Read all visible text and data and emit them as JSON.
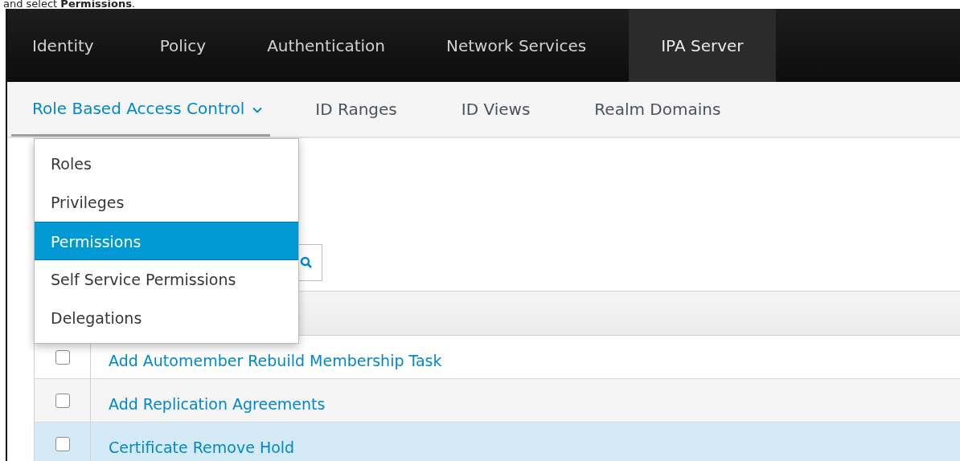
{
  "caption": "and select **Permissions**.",
  "top_nav": [
    {
      "label": "Identity",
      "selected": false
    },
    {
      "label": "Policy",
      "selected": false
    },
    {
      "label": "Authentication",
      "selected": false
    },
    {
      "label": "Network Services",
      "selected": false
    },
    {
      "label": "IPA Server",
      "selected": true
    }
  ],
  "sub_nav": [
    {
      "label": "Role Based Access Control",
      "selected": true,
      "dropdown": true
    },
    {
      "label": "ID Ranges",
      "selected": false,
      "dropdown": false
    },
    {
      "label": "ID Views",
      "selected": false,
      "dropdown": false
    },
    {
      "label": "Realm Domains",
      "selected": false,
      "dropdown": false
    }
  ],
  "dropdown_menu": [
    {
      "label": "Roles",
      "selected": false
    },
    {
      "label": "Privileges",
      "selected": false
    },
    {
      "label": "Permissions",
      "selected": true
    },
    {
      "label": "Self Service Permissions",
      "selected": false
    },
    {
      "label": "Delegations",
      "selected": false
    }
  ],
  "table": {
    "rows": [
      {
        "name": "Add Automember Rebuild Membership Task",
        "checked": false,
        "selected": false
      },
      {
        "name": "Add Replication Agreements",
        "checked": false,
        "selected": false
      },
      {
        "name": "Certificate Remove Hold",
        "checked": false,
        "selected": true
      }
    ]
  }
}
